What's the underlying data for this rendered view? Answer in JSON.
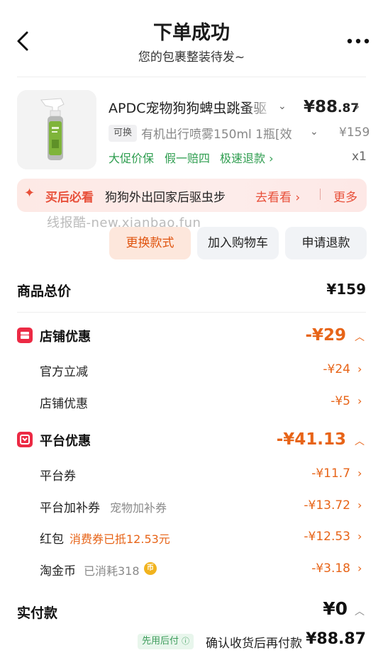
{
  "header": {
    "title": "下单成功",
    "subtitle": "您的包裹整装待发~"
  },
  "product": {
    "title": "APDC宠物狗狗蜱虫跳蚤驱",
    "price_main": "¥88",
    "price_cents": ".87",
    "swap_tag": "可换",
    "spec": "有机出行喷雾150ml 1瓶[效",
    "original_price": "¥159",
    "promo_1": "大促价保",
    "promo_2": "假一赔四",
    "promo_3": "极速退款",
    "quantity": "x1"
  },
  "banner": {
    "must_see": "买后必看",
    "text": "狗狗外出回家后驱虫步",
    "go_see": "去看看",
    "more": "更多"
  },
  "watermark": "线报酷-new.xianbao.fun",
  "actions": {
    "change_style": "更换款式",
    "add_cart": "加入购物车",
    "refund": "申请退款"
  },
  "summary": {
    "total_label": "商品总价",
    "total_value": "¥159",
    "shop_discount_label": "店铺优惠",
    "shop_discount_value": "-¥29",
    "official_cut_label": "官方立减",
    "official_cut_value": "-¥24",
    "shop_coupon_label": "店铺优惠",
    "shop_coupon_value": "-¥5",
    "platform_discount_label": "平台优惠",
    "platform_discount_value": "-¥41.13",
    "platform_coupon_label": "平台券",
    "platform_coupon_value": "-¥11.7",
    "platform_bonus_label": "平台加补券",
    "platform_bonus_note": "宠物加补券",
    "platform_bonus_value": "-¥13.72",
    "red_packet_label": "红包",
    "red_packet_note": "消费券已抵12.53元",
    "red_packet_value": "-¥12.53",
    "taojinbi_label": "淘金币",
    "taojinbi_note": "已消耗318",
    "taojinbi_coin": "币",
    "taojinbi_value": "-¥3.18",
    "paid_label": "实付款",
    "paid_value": "¥0",
    "pay_later_tag": "先用后付",
    "pay_later_text": "确认收货后再付款",
    "pay_later_amount": "¥88.87"
  },
  "colors": {
    "accent_orange": "#e76418",
    "accent_red": "#ec2a44",
    "promo_green": "#2e9d4f"
  }
}
